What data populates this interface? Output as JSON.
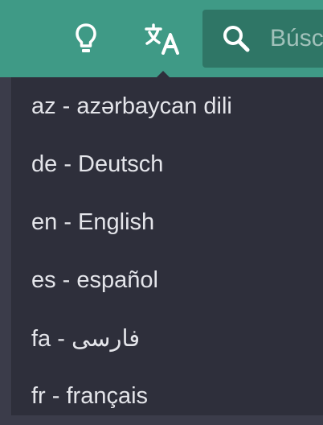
{
  "header": {
    "background_color": "#3f9a86",
    "icons": [
      "lightbulb-icon",
      "translate-icon",
      "search-icon"
    ]
  },
  "search": {
    "placeholder": "Búsc"
  },
  "language_menu": {
    "items": [
      {
        "label": "az - azərbaycan dili"
      },
      {
        "label": "de - Deutsch"
      },
      {
        "label": "en - English"
      },
      {
        "label": "es - español"
      },
      {
        "label": "fa - فارسی"
      },
      {
        "label": "fr - français"
      }
    ]
  }
}
